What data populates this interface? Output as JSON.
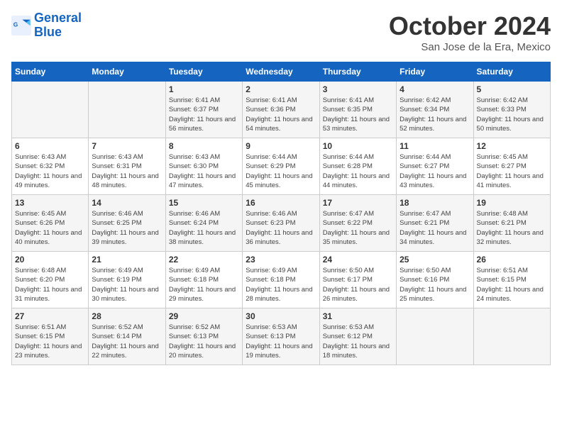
{
  "header": {
    "logo_line1": "General",
    "logo_line2": "Blue",
    "month_title": "October 2024",
    "location": "San Jose de la Era, Mexico"
  },
  "days_of_week": [
    "Sunday",
    "Monday",
    "Tuesday",
    "Wednesday",
    "Thursday",
    "Friday",
    "Saturday"
  ],
  "weeks": [
    [
      {
        "day": "",
        "sunrise": "",
        "sunset": "",
        "daylight": ""
      },
      {
        "day": "",
        "sunrise": "",
        "sunset": "",
        "daylight": ""
      },
      {
        "day": "1",
        "sunrise": "Sunrise: 6:41 AM",
        "sunset": "Sunset: 6:37 PM",
        "daylight": "Daylight: 11 hours and 56 minutes."
      },
      {
        "day": "2",
        "sunrise": "Sunrise: 6:41 AM",
        "sunset": "Sunset: 6:36 PM",
        "daylight": "Daylight: 11 hours and 54 minutes."
      },
      {
        "day": "3",
        "sunrise": "Sunrise: 6:41 AM",
        "sunset": "Sunset: 6:35 PM",
        "daylight": "Daylight: 11 hours and 53 minutes."
      },
      {
        "day": "4",
        "sunrise": "Sunrise: 6:42 AM",
        "sunset": "Sunset: 6:34 PM",
        "daylight": "Daylight: 11 hours and 52 minutes."
      },
      {
        "day": "5",
        "sunrise": "Sunrise: 6:42 AM",
        "sunset": "Sunset: 6:33 PM",
        "daylight": "Daylight: 11 hours and 50 minutes."
      }
    ],
    [
      {
        "day": "6",
        "sunrise": "Sunrise: 6:43 AM",
        "sunset": "Sunset: 6:32 PM",
        "daylight": "Daylight: 11 hours and 49 minutes."
      },
      {
        "day": "7",
        "sunrise": "Sunrise: 6:43 AM",
        "sunset": "Sunset: 6:31 PM",
        "daylight": "Daylight: 11 hours and 48 minutes."
      },
      {
        "day": "8",
        "sunrise": "Sunrise: 6:43 AM",
        "sunset": "Sunset: 6:30 PM",
        "daylight": "Daylight: 11 hours and 47 minutes."
      },
      {
        "day": "9",
        "sunrise": "Sunrise: 6:44 AM",
        "sunset": "Sunset: 6:29 PM",
        "daylight": "Daylight: 11 hours and 45 minutes."
      },
      {
        "day": "10",
        "sunrise": "Sunrise: 6:44 AM",
        "sunset": "Sunset: 6:28 PM",
        "daylight": "Daylight: 11 hours and 44 minutes."
      },
      {
        "day": "11",
        "sunrise": "Sunrise: 6:44 AM",
        "sunset": "Sunset: 6:27 PM",
        "daylight": "Daylight: 11 hours and 43 minutes."
      },
      {
        "day": "12",
        "sunrise": "Sunrise: 6:45 AM",
        "sunset": "Sunset: 6:27 PM",
        "daylight": "Daylight: 11 hours and 41 minutes."
      }
    ],
    [
      {
        "day": "13",
        "sunrise": "Sunrise: 6:45 AM",
        "sunset": "Sunset: 6:26 PM",
        "daylight": "Daylight: 11 hours and 40 minutes."
      },
      {
        "day": "14",
        "sunrise": "Sunrise: 6:46 AM",
        "sunset": "Sunset: 6:25 PM",
        "daylight": "Daylight: 11 hours and 39 minutes."
      },
      {
        "day": "15",
        "sunrise": "Sunrise: 6:46 AM",
        "sunset": "Sunset: 6:24 PM",
        "daylight": "Daylight: 11 hours and 38 minutes."
      },
      {
        "day": "16",
        "sunrise": "Sunrise: 6:46 AM",
        "sunset": "Sunset: 6:23 PM",
        "daylight": "Daylight: 11 hours and 36 minutes."
      },
      {
        "day": "17",
        "sunrise": "Sunrise: 6:47 AM",
        "sunset": "Sunset: 6:22 PM",
        "daylight": "Daylight: 11 hours and 35 minutes."
      },
      {
        "day": "18",
        "sunrise": "Sunrise: 6:47 AM",
        "sunset": "Sunset: 6:21 PM",
        "daylight": "Daylight: 11 hours and 34 minutes."
      },
      {
        "day": "19",
        "sunrise": "Sunrise: 6:48 AM",
        "sunset": "Sunset: 6:21 PM",
        "daylight": "Daylight: 11 hours and 32 minutes."
      }
    ],
    [
      {
        "day": "20",
        "sunrise": "Sunrise: 6:48 AM",
        "sunset": "Sunset: 6:20 PM",
        "daylight": "Daylight: 11 hours and 31 minutes."
      },
      {
        "day": "21",
        "sunrise": "Sunrise: 6:49 AM",
        "sunset": "Sunset: 6:19 PM",
        "daylight": "Daylight: 11 hours and 30 minutes."
      },
      {
        "day": "22",
        "sunrise": "Sunrise: 6:49 AM",
        "sunset": "Sunset: 6:18 PM",
        "daylight": "Daylight: 11 hours and 29 minutes."
      },
      {
        "day": "23",
        "sunrise": "Sunrise: 6:49 AM",
        "sunset": "Sunset: 6:18 PM",
        "daylight": "Daylight: 11 hours and 28 minutes."
      },
      {
        "day": "24",
        "sunrise": "Sunrise: 6:50 AM",
        "sunset": "Sunset: 6:17 PM",
        "daylight": "Daylight: 11 hours and 26 minutes."
      },
      {
        "day": "25",
        "sunrise": "Sunrise: 6:50 AM",
        "sunset": "Sunset: 6:16 PM",
        "daylight": "Daylight: 11 hours and 25 minutes."
      },
      {
        "day": "26",
        "sunrise": "Sunrise: 6:51 AM",
        "sunset": "Sunset: 6:15 PM",
        "daylight": "Daylight: 11 hours and 24 minutes."
      }
    ],
    [
      {
        "day": "27",
        "sunrise": "Sunrise: 6:51 AM",
        "sunset": "Sunset: 6:15 PM",
        "daylight": "Daylight: 11 hours and 23 minutes."
      },
      {
        "day": "28",
        "sunrise": "Sunrise: 6:52 AM",
        "sunset": "Sunset: 6:14 PM",
        "daylight": "Daylight: 11 hours and 22 minutes."
      },
      {
        "day": "29",
        "sunrise": "Sunrise: 6:52 AM",
        "sunset": "Sunset: 6:13 PM",
        "daylight": "Daylight: 11 hours and 20 minutes."
      },
      {
        "day": "30",
        "sunrise": "Sunrise: 6:53 AM",
        "sunset": "Sunset: 6:13 PM",
        "daylight": "Daylight: 11 hours and 19 minutes."
      },
      {
        "day": "31",
        "sunrise": "Sunrise: 6:53 AM",
        "sunset": "Sunset: 6:12 PM",
        "daylight": "Daylight: 11 hours and 18 minutes."
      },
      {
        "day": "",
        "sunrise": "",
        "sunset": "",
        "daylight": ""
      },
      {
        "day": "",
        "sunrise": "",
        "sunset": "",
        "daylight": ""
      }
    ]
  ]
}
